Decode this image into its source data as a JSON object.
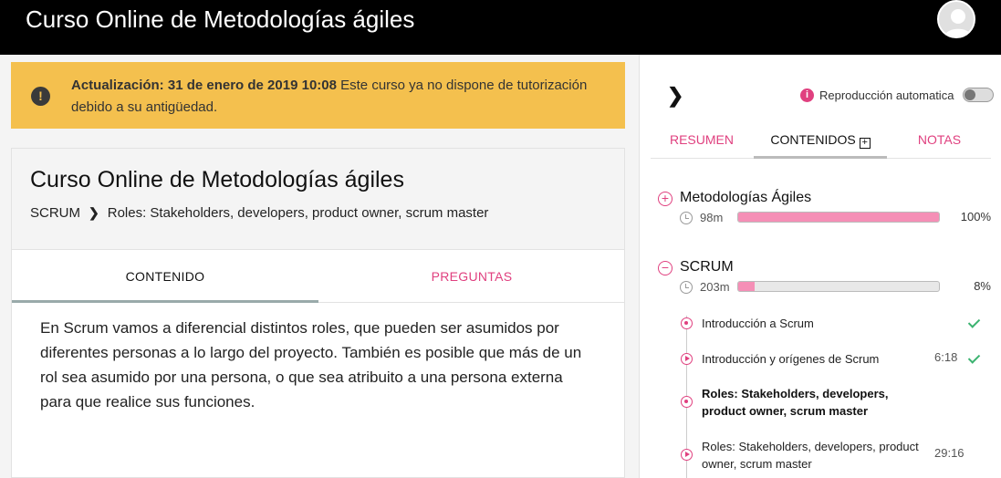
{
  "header": {
    "title": "Curso Online de Metodologías ágiles"
  },
  "alert": {
    "bold": "Actualización: 31 de enero de 2019 10:08",
    "text": " Este curso ya no dispone de tutorización debido a su antigüedad."
  },
  "course": {
    "title": "Curso Online de Metodologías ágiles",
    "breadcrumb": [
      "SCRUM",
      "Roles: Stakeholders, developers, product owner, scrum master"
    ]
  },
  "left_tabs": [
    {
      "label": "CONTENIDO"
    },
    {
      "label": "PREGUNTAS"
    }
  ],
  "content": {
    "paragraph": "En Scrum vamos a diferencial distintos roles, que pueden ser asumidos por diferentes personas a lo largo del proyecto. También es posible que más de un rol sea asumido por una persona, o que sea atribuito a una persona externa para que realice sus funciones."
  },
  "sidebar": {
    "autoplay_label": "Reproducción automatica",
    "autoplay_on": false,
    "tabs": [
      {
        "label": "RESUMEN"
      },
      {
        "label": "CONTENIDOS"
      },
      {
        "label": "NOTAS"
      }
    ],
    "sections": [
      {
        "title": "Metodologías Ágiles",
        "duration": "98m",
        "progress": 100,
        "progress_label": "100%",
        "expanded": false
      },
      {
        "title": "SCRUM",
        "duration": "203m",
        "progress": 8,
        "progress_label": "8%",
        "expanded": true
      }
    ],
    "lessons": [
      {
        "title": "Introducción a Scrum",
        "time": "",
        "done": true,
        "type": "text",
        "current": false
      },
      {
        "title": "Introducción y orígenes de Scrum",
        "time": "6:18",
        "done": true,
        "type": "video",
        "current": false
      },
      {
        "title": "Roles: Stakeholders, developers, product owner, scrum master",
        "time": "",
        "done": false,
        "type": "text",
        "current": true
      },
      {
        "title": "Roles: Stakeholders, developers, product owner, scrum master",
        "time": "29:16",
        "done": false,
        "type": "video",
        "current": false
      }
    ]
  },
  "colors": {
    "accent": "#e0407f",
    "alert_bg": "#f4c04e",
    "progress_fill": "#f58fb6",
    "check": "#3cb371"
  }
}
